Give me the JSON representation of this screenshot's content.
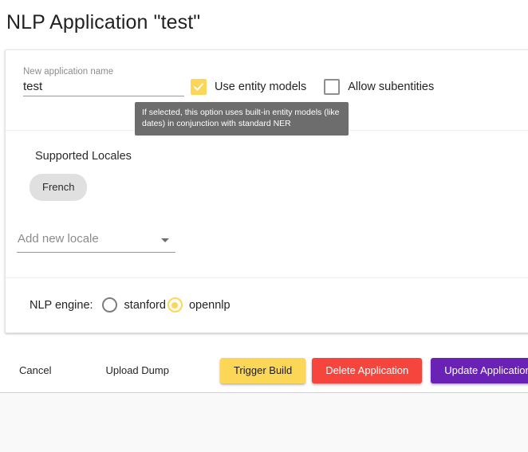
{
  "page": {
    "title": "NLP Application \"test\""
  },
  "name_section": {
    "label": "New application name",
    "value": "test",
    "placeholder": "New application name",
    "checkboxes": [
      {
        "label": "Use entity models",
        "checked": true
      },
      {
        "label": "Allow subentities",
        "checked": false
      }
    ],
    "tooltip": {
      "line1": "If selected, this option uses built-in entity models (like",
      "line2": "dates) in conjunction with standard NER"
    }
  },
  "locales_section": {
    "heading": "Supported Locales",
    "chips": [
      "French"
    ],
    "add_locale_placeholder": "Add new locale"
  },
  "engine_section": {
    "caption": "NLP engine:",
    "options": [
      {
        "label": "stanford",
        "selected": false
      },
      {
        "label": "opennlp",
        "selected": true
      }
    ]
  },
  "actions": {
    "cancel": "Cancel",
    "upload_dump": "Upload Dump",
    "trigger_build": "Trigger Build",
    "delete_application": "Delete Application",
    "update_application": "Update Application"
  },
  "colors": {
    "accent_yellow": "#fcd757",
    "danger_red": "#f6453d",
    "primary_purple": "#6a21b5",
    "chip_grey": "#e0e0e0",
    "tooltip_grey": "#6d6d6d"
  }
}
